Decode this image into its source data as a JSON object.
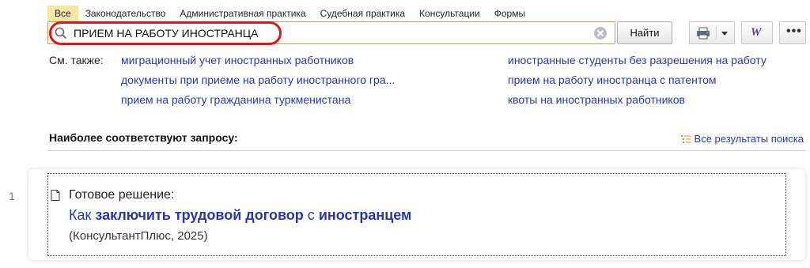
{
  "tabs": [
    {
      "label": "Все",
      "active": true
    },
    {
      "label": "Законодательство"
    },
    {
      "label": "Административная практика"
    },
    {
      "label": "Судебная практика"
    },
    {
      "label": "Консультации"
    },
    {
      "label": "Формы"
    }
  ],
  "search": {
    "value": "ПРИЕМ НА РАБОТУ ИНОСТРАНЦА",
    "button_label": "Найти"
  },
  "see_also": {
    "label": "См. также:",
    "links": [
      "миграционный учет иностранных работников",
      "документы при приеме на работу иностранного гра...",
      "прием на работу гражданина туркменистана",
      "иностранные студенты без разрешения на работу",
      "прием на работу иностранца с патентом",
      "квоты на иностранных работников"
    ]
  },
  "results_section": {
    "title": "Наиболее соответствуют запросу:",
    "all_results_label": "Все результаты поиска"
  },
  "results": [
    {
      "number": "1",
      "type": "Готовое решение:",
      "title_parts": [
        "Как ",
        "заключить трудовой договор",
        " с ",
        "иностранцем"
      ],
      "source": "(КонсультантПлюс, 2025)"
    }
  ],
  "icons": {
    "search": "search-icon",
    "clear": "clear-icon",
    "print": "print-icon",
    "word": "word-icon",
    "more": "more-icon",
    "all_results": "list-icon",
    "document": "document-icon"
  },
  "colors": {
    "link": "#2a35b0",
    "active_tab": "#f7e6a6",
    "highlight_ring": "#e3121b",
    "search_border": "#c7a24a"
  }
}
